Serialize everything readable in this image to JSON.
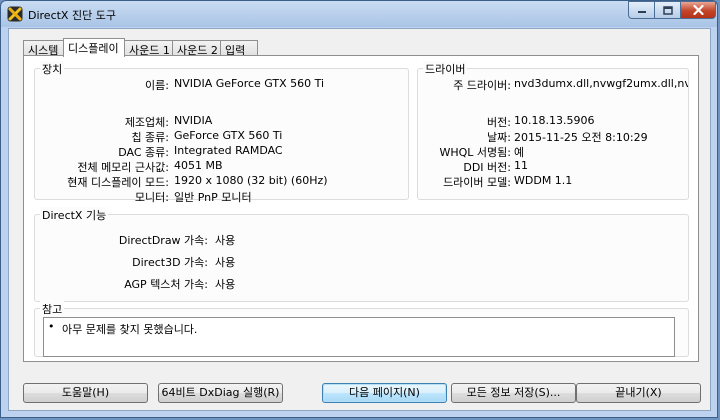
{
  "window": {
    "title": "DirectX 진단 도구"
  },
  "tabs": [
    {
      "label": "시스템",
      "active": false
    },
    {
      "label": "디스플레이",
      "active": true
    },
    {
      "label": "사운드 1",
      "active": false
    },
    {
      "label": "사운드 2",
      "active": false
    },
    {
      "label": "입력",
      "active": false
    }
  ],
  "device": {
    "section_label": "장치",
    "rows": [
      {
        "label": "이름:",
        "value": "NVIDIA GeForce GTX 560 Ti"
      },
      {
        "label": "제조업체:",
        "value": "NVIDIA"
      },
      {
        "label": "칩 종류:",
        "value": "GeForce GTX 560 Ti"
      },
      {
        "label": "DAC 종류:",
        "value": "Integrated RAMDAC"
      },
      {
        "label": "전체 메모리 근사값:",
        "value": "4051 MB"
      },
      {
        "label": "현재 디스플레이 모드:",
        "value": "1920 x 1080 (32 bit) (60Hz)"
      },
      {
        "label": "모니터:",
        "value": "일반 PnP 모니터"
      }
    ]
  },
  "driver": {
    "section_label": "드라이버",
    "rows": [
      {
        "label": "주 드라이버:",
        "value": "nvd3dumx.dll,nvwgf2umx.dll,nvwgf2u"
      },
      {
        "label": "버전:",
        "value": "10.18.13.5906"
      },
      {
        "label": "날짜:",
        "value": "2015-11-25 오전 8:10:29"
      },
      {
        "label": "WHQL 서명됨:",
        "value": "예"
      },
      {
        "label": "DDI 버전:",
        "value": "11"
      },
      {
        "label": "드라이버 모델:",
        "value": "WDDM 1.1"
      }
    ]
  },
  "directx": {
    "section_label": "DirectX 기능",
    "rows": [
      {
        "label": "DirectDraw 가속:",
        "value": "사용"
      },
      {
        "label": "Direct3D 가속:",
        "value": "사용"
      },
      {
        "label": "AGP 텍스처 가속:",
        "value": "사용"
      }
    ]
  },
  "notes": {
    "section_label": "참고",
    "bullet": "•",
    "text": "아무 문제를 찾지 못했습니다."
  },
  "buttons": {
    "help": "도움말(H)",
    "dxdiag64": "64비트 DxDiag 실행(R)",
    "next_page": "다음 페이지(N)",
    "save_all": "모든 정보 저장(S)...",
    "exit": "끝내기(X)"
  },
  "colors": {
    "title_bar": "#a9c4e6",
    "close_button": "#c3442a",
    "default_button_border": "#3c7fb1"
  }
}
